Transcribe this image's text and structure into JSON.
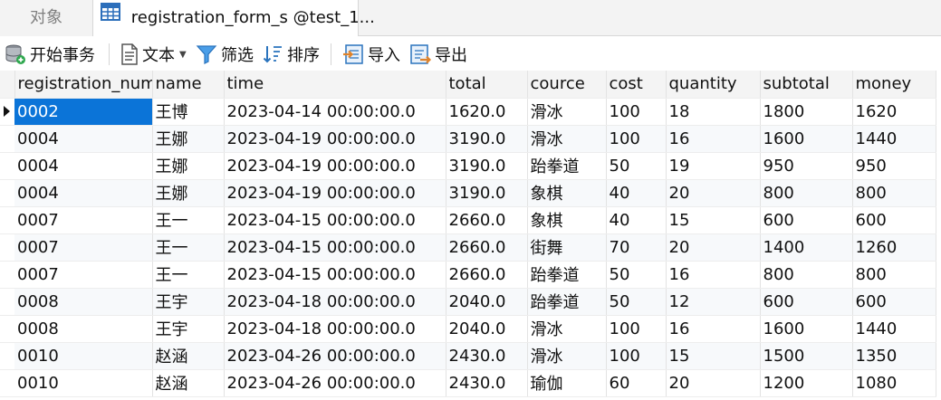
{
  "tabs": {
    "objects_label": "对象",
    "active_label": "registration_form_s @test_1..."
  },
  "toolbar": {
    "begin_transaction": "开始事务",
    "text": "文本",
    "filter": "筛选",
    "sort": "排序",
    "import": "导入",
    "export": "导出"
  },
  "grid": {
    "columns": [
      "registration_num",
      "name",
      "time",
      "total",
      "cource",
      "cost",
      "quantity",
      "subtotal",
      "money"
    ],
    "rows": [
      [
        "0002",
        "王博",
        "2023-04-14 00:00:00.0",
        "1620.0",
        "滑冰",
        "100",
        "18",
        "1800",
        "1620"
      ],
      [
        "0004",
        "王娜",
        "2023-04-19 00:00:00.0",
        "3190.0",
        "滑冰",
        "100",
        "16",
        "1600",
        "1440"
      ],
      [
        "0004",
        "王娜",
        "2023-04-19 00:00:00.0",
        "3190.0",
        "跆拳道",
        "50",
        "19",
        "950",
        "950"
      ],
      [
        "0004",
        "王娜",
        "2023-04-19 00:00:00.0",
        "3190.0",
        "象棋",
        "40",
        "20",
        "800",
        "800"
      ],
      [
        "0007",
        "王一",
        "2023-04-15 00:00:00.0",
        "2660.0",
        "象棋",
        "40",
        "15",
        "600",
        "600"
      ],
      [
        "0007",
        "王一",
        "2023-04-15 00:00:00.0",
        "2660.0",
        "街舞",
        "70",
        "20",
        "1400",
        "1260"
      ],
      [
        "0007",
        "王一",
        "2023-04-15 00:00:00.0",
        "2660.0",
        "跆拳道",
        "50",
        "16",
        "800",
        "800"
      ],
      [
        "0008",
        "王宇",
        "2023-04-18 00:00:00.0",
        "2040.0",
        "跆拳道",
        "50",
        "12",
        "600",
        "600"
      ],
      [
        "0008",
        "王宇",
        "2023-04-18 00:00:00.0",
        "2040.0",
        "滑冰",
        "100",
        "16",
        "1600",
        "1440"
      ],
      [
        "0010",
        "赵涵",
        "2023-04-26 00:00:00.0",
        "2430.0",
        "滑冰",
        "100",
        "15",
        "1500",
        "1350"
      ],
      [
        "0010",
        "赵涵",
        "2023-04-26 00:00:00.0",
        "2430.0",
        "瑜伽",
        "60",
        "20",
        "1200",
        "1080"
      ]
    ]
  }
}
